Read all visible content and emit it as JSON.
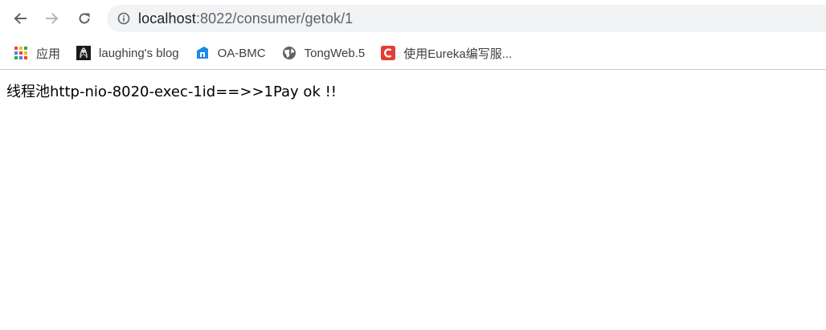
{
  "browser": {
    "address_bar": {
      "host": "localhost",
      "path": ":8022/consumer/getok/1"
    },
    "bookmarks": [
      {
        "label": "应用",
        "icon": "apps-grid-icon"
      },
      {
        "label": "laughing's blog",
        "icon": "blog-avatar-icon"
      },
      {
        "label": "OA-BMC",
        "icon": "oa-bmc-icon"
      },
      {
        "label": "TongWeb.5",
        "icon": "globe-icon"
      },
      {
        "label": "使用Eureka编写服...",
        "icon": "csdn-c-icon"
      }
    ]
  },
  "page": {
    "body_text": "线程池http-nio-8020-exec-1id==>>1Pay ok !!"
  },
  "colors": {
    "omnibox_bg": "#f1f3f4",
    "csdn_red": "#e33e33",
    "oa_blue": "#1e88e5"
  }
}
